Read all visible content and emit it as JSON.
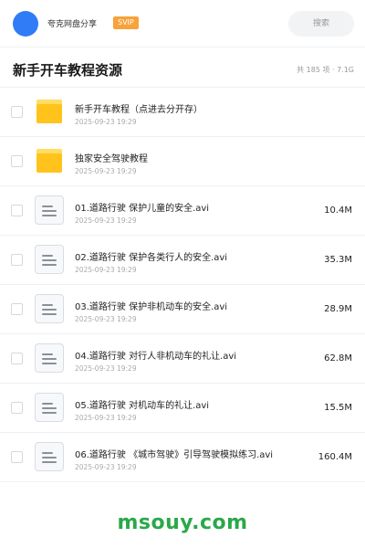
{
  "header": {
    "owner_name": "夸克网盘分享",
    "badge": "SVIP",
    "search_placeholder": "搜索"
  },
  "folder": {
    "title": "新手开车教程资源",
    "summary": "共 185 项 · 7.1G"
  },
  "items": [
    {
      "type": "folder",
      "name": "新手开车教程（点进去分开存）",
      "date": "2025-09-23 19:29",
      "size": ""
    },
    {
      "type": "folder",
      "name": "独家安全驾驶教程",
      "date": "2025-09-23 19:29",
      "size": ""
    },
    {
      "type": "file",
      "name": "01.道路行驶 保护儿童的安全.avi",
      "date": "2025-09-23 19:29",
      "size": "10.4M"
    },
    {
      "type": "file",
      "name": "02.道路行驶 保护各类行人的安全.avi",
      "date": "2025-09-23 19:29",
      "size": "35.3M"
    },
    {
      "type": "file",
      "name": "03.道路行驶 保护非机动车的安全.avi",
      "date": "2025-09-23 19:29",
      "size": "28.9M"
    },
    {
      "type": "file",
      "name": "04.道路行驶 对行人非机动车的礼让.avi",
      "date": "2025-09-23 19:29",
      "size": "62.8M"
    },
    {
      "type": "file",
      "name": "05.道路行驶 对机动车的礼让.avi",
      "date": "2025-09-23 19:29",
      "size": "15.5M"
    },
    {
      "type": "file",
      "name": "06.道路行驶 《城市驾驶》引导驾驶模拟练习.avi",
      "date": "2025-09-23 19:29",
      "size": "160.4M"
    }
  ],
  "watermark": "msouy.com",
  "colors": {
    "avatar": "#2f7cf6",
    "badge": "#f7a23b",
    "folder": "#ffc31c",
    "watermark": "#2aa84a"
  }
}
